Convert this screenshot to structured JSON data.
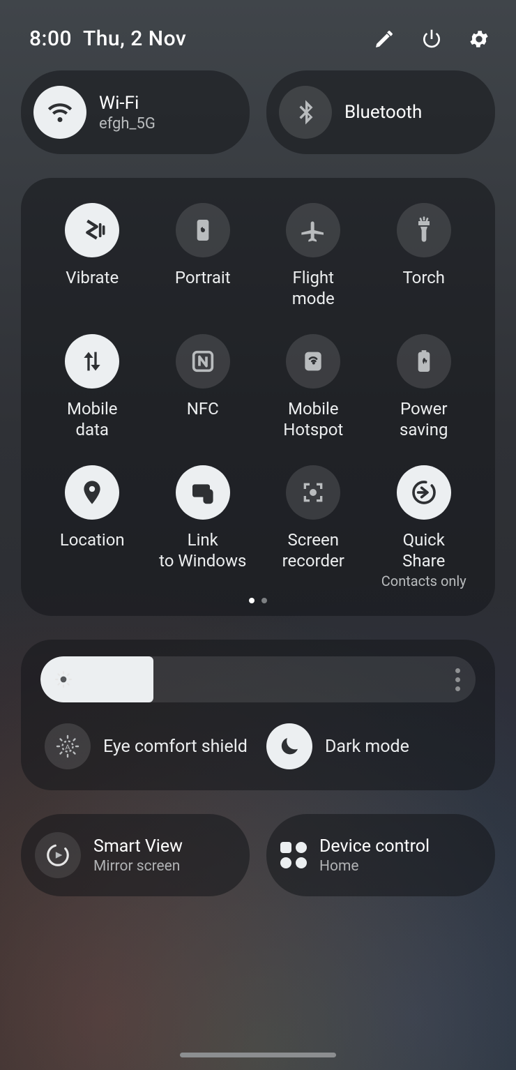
{
  "header": {
    "time": "8:00",
    "date": "Thu, 2 Nov"
  },
  "top": {
    "wifi": {
      "title": "Wi-Fi",
      "subtitle": "efgh_5G",
      "on": true
    },
    "bluetooth": {
      "title": "Bluetooth",
      "on": false
    }
  },
  "tiles": [
    {
      "id": "vibrate",
      "label": "Vibrate",
      "on": true,
      "icon": "vibrate"
    },
    {
      "id": "portrait",
      "label": "Portrait",
      "on": false,
      "icon": "portrait"
    },
    {
      "id": "flight",
      "label": "Flight mode",
      "on": false,
      "icon": "airplane"
    },
    {
      "id": "torch",
      "label": "Torch",
      "on": false,
      "icon": "torch"
    },
    {
      "id": "mobiledata",
      "label": "Mobile data",
      "on": true,
      "icon": "updown"
    },
    {
      "id": "nfc",
      "label": "NFC",
      "on": false,
      "icon": "nfc"
    },
    {
      "id": "hotspot",
      "label": "Mobile Hotspot",
      "on": false,
      "icon": "hotspot"
    },
    {
      "id": "powersave",
      "label": "Power saving",
      "on": false,
      "icon": "battery"
    },
    {
      "id": "location",
      "label": "Location",
      "on": true,
      "icon": "location"
    },
    {
      "id": "linkwindows",
      "label": "Link to Windows",
      "on": true,
      "icon": "linkwin"
    },
    {
      "id": "screenrec",
      "label": "Screen recorder",
      "on": false,
      "icon": "screenrec"
    },
    {
      "id": "quickshare",
      "label": "Quick Share",
      "on": true,
      "icon": "quickshare",
      "sub": "Contacts only"
    }
  ],
  "pages": {
    "count": 2,
    "active": 0
  },
  "brightness": {
    "percent": 26,
    "eyeComfort": {
      "label": "Eye comfort shield",
      "on": false
    },
    "darkMode": {
      "label": "Dark mode",
      "on": true
    }
  },
  "bottom": {
    "smartview": {
      "title": "Smart View",
      "subtitle": "Mirror screen"
    },
    "devicecontrol": {
      "title": "Device control",
      "subtitle": "Home"
    }
  }
}
